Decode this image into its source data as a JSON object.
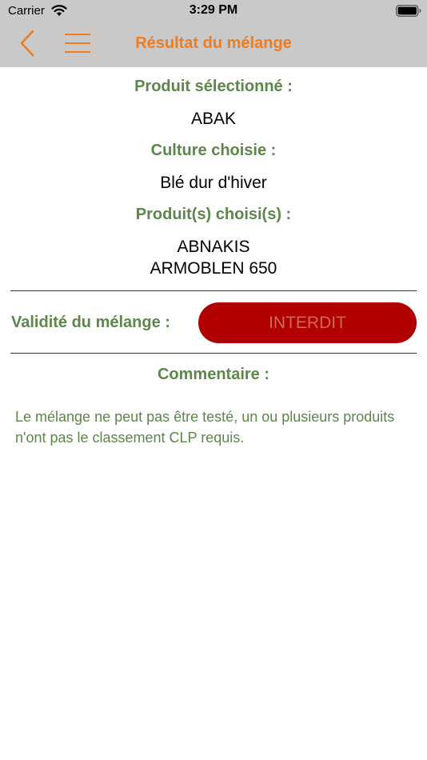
{
  "status_bar": {
    "carrier": "Carrier",
    "time": "3:29 PM"
  },
  "header": {
    "title": "Résultat du mélange",
    "back_icon": "chevron-left-icon",
    "menu_icon": "hamburger-icon"
  },
  "product": {
    "label": "Produit sélectionné :",
    "value": "ABAK"
  },
  "culture": {
    "label": "Culture choisie :",
    "value": "Blé dur d'hiver"
  },
  "chosen_products": {
    "label": "Produit(s) choisi(s) :",
    "items": [
      "ABNAKIS",
      "ARMOBLEN 650"
    ]
  },
  "validity": {
    "label": "Validité du mélange :",
    "status": "INTERDIT"
  },
  "comment": {
    "label": "Commentaire :",
    "text": "Le mélange ne peut pas être testé, un ou plusieurs produits n'ont pas le classement CLP requis."
  },
  "colors": {
    "accent_orange": "#ef7c1e",
    "label_green": "#5b8749",
    "status_red": "#b00000",
    "header_gray": "#c9c9c9"
  }
}
